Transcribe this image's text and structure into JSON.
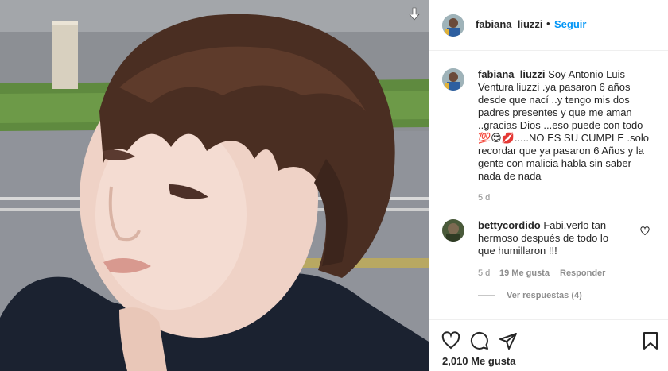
{
  "post": {
    "username": "fabiana_liuzzi",
    "separator": "•",
    "follow_label": "Seguir",
    "caption_lines": [
      "Soy Antonio Luis",
      "Ventura liuzzi .ya pasaron 6 años",
      "desde que nací ..y tengo mis dos",
      "padres presentes y que me aman",
      "..gracias Dios ...eso puede con todo",
      "💯😍💋.....NO ES SU CUMPLE .solo",
      "recordar que ya pasaron 6 Años y la",
      "gente con malicia habla sin saber",
      "nada de nada"
    ],
    "caption_time": "5 d",
    "likes_label": "2,010 Me gusta"
  },
  "comment": {
    "username": "bettycordido",
    "text_lines": [
      "Fabi,verlo tan",
      "hermoso después de todo lo",
      "que humillaron !!!"
    ],
    "time": "5 d",
    "likes": "19 Me gusta",
    "reply_label": "Responder",
    "view_replies": "Ver respuestas (4)"
  },
  "icons": {
    "save_overlay": "download-icon",
    "like": "heart-icon",
    "comment": "comment-icon",
    "share": "share-icon",
    "save": "bookmark-icon"
  },
  "colors": {
    "link_blue": "#0095f6",
    "text": "#262626",
    "muted": "#8e8e8e",
    "border": "#efefef"
  }
}
